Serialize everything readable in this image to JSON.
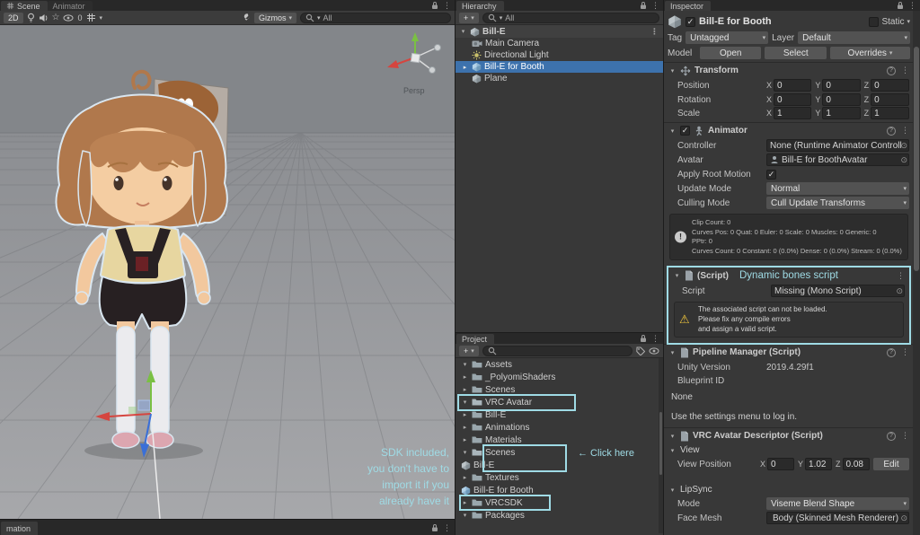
{
  "colors": {
    "annotation_cyan": "#9fdbe5",
    "selection_blue": "#3d72ad",
    "warning_yellow": "#f3c83c",
    "axis_x_red": "#d5453f",
    "axis_y_green": "#7ac043",
    "axis_z_blue": "#3a6fd8"
  },
  "axes": {
    "x": "X",
    "y": "Y",
    "z": "Z"
  },
  "scene_pane": {
    "tabs": {
      "scene": "Scene",
      "animator": "Animator"
    },
    "toolbar": {
      "mode_2d": "2D",
      "hidden_count": "0",
      "gizmos": "Gizmos",
      "search_value": "All"
    },
    "viewport": {
      "persp_label": "Persp"
    },
    "sdk_note_lines": [
      "SDK included,",
      "you don't have to",
      "import it if you",
      "already have it"
    ],
    "bottom_tab": "mation"
  },
  "hierarchy": {
    "tab": "Hierarchy",
    "create_label": "+",
    "search_value": "All",
    "scene_row": {
      "label": "Bill-E"
    },
    "items": [
      {
        "label": "Main Camera"
      },
      {
        "label": "Directional Light"
      },
      {
        "label": "Bill-E for Booth"
      },
      {
        "label": "Plane"
      }
    ]
  },
  "project": {
    "tab": "Project",
    "create_label": "+",
    "search_value": "",
    "click_here": "← Click here",
    "rows": [
      {
        "arrow": "▾",
        "label": "Assets"
      },
      {
        "arrow": "▸",
        "label": "_PolyomiShaders"
      },
      {
        "arrow": "▸",
        "label": "Scenes"
      },
      {
        "arrow": "▾",
        "label": "VRC Avatar"
      },
      {
        "arrow": "▸",
        "label": "Bill-E"
      },
      {
        "arrow": "▸",
        "label": "Animations"
      },
      {
        "arrow": "▸",
        "label": "Materials"
      },
      {
        "arrow": "▾",
        "label": "Scenes"
      },
      {
        "arrow": "",
        "label": "Bill-E"
      },
      {
        "arrow": "▸",
        "label": "Textures"
      },
      {
        "arrow": "",
        "label": "Bill-E for Booth"
      },
      {
        "arrow": "▸",
        "label": "VRCSDK"
      },
      {
        "arrow": "▾",
        "label": "Packages"
      }
    ]
  },
  "inspector": {
    "tab": "Inspector",
    "header": {
      "title": "Bill-E for Booth",
      "static_label": "Static",
      "tag_label": "Tag",
      "tag_value": "Untagged",
      "layer_label": "Layer",
      "layer_value": "Default",
      "model_label": "Model",
      "open_button": "Open",
      "select_button": "Select",
      "overrides_button": "Overrides"
    },
    "transform": {
      "title": "Transform",
      "position_label": "Position",
      "rotation_label": "Rotation",
      "scale_label": "Scale",
      "position": {
        "x": "0",
        "y": "0",
        "z": "0"
      },
      "rotation": {
        "x": "0",
        "y": "0",
        "z": "0"
      },
      "scale": {
        "x": "1",
        "y": "1",
        "z": "1"
      }
    },
    "animator": {
      "title": "Animator",
      "controller_label": "Controller",
      "controller_value": "None (Runtime Animator Controll",
      "avatar_label": "Avatar",
      "avatar_value": "Bill-E for BoothAvatar",
      "apply_root_motion_label": "Apply Root Motion",
      "update_mode_label": "Update Mode",
      "update_mode_value": "Normal",
      "culling_mode_label": "Culling Mode",
      "culling_mode_value": "Cull Update Transforms",
      "info_lines": [
        "Clip Count: 0",
        "Curves Pos: 0 Quat: 0 Euler: 0 Scale: 0 Muscles: 0 Generic: 0",
        "PPtr: 0",
        "Curves Count: 0 Constant: 0 (0.0%) Dense: 0 (0.0%) Stream: 0 (0.0%)"
      ]
    },
    "missing_script": {
      "title": "(Script)",
      "annotation": "Dynamic bones script",
      "script_label": "Script",
      "script_value": "Missing (Mono Script)",
      "warning_lines": [
        "The associated script can not be loaded.",
        "Please fix any compile errors",
        "and assign a valid script."
      ]
    },
    "pipeline": {
      "title": "Pipeline Manager (Script)",
      "unity_version_label": "Unity Version",
      "unity_version_value": "2019.4.29f1",
      "blueprint_id_label": "Blueprint ID",
      "blueprint_none": "None",
      "settings_hint": "Use the settings menu to log in."
    },
    "descriptor": {
      "title": "VRC Avatar Descriptor (Script)",
      "view_label": "View",
      "view_position_label": "View Position",
      "view_position": {
        "x": "0",
        "y": "1.02",
        "z": "0.08"
      },
      "edit_button": "Edit",
      "lipsync_label": "LipSync",
      "mode_label": "Mode",
      "mode_value": "Viseme Blend Shape",
      "face_mesh_label": "Face Mesh",
      "face_mesh_value": "Body (Skinned Mesh Renderer)"
    }
  }
}
